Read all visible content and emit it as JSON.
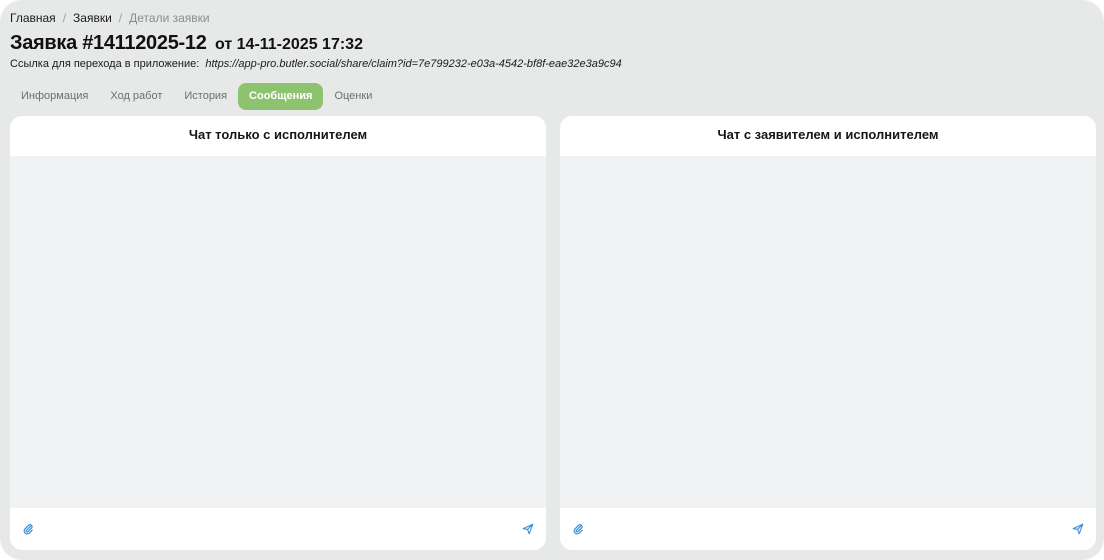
{
  "breadcrumb": {
    "items": [
      "Главная",
      "Заявки",
      "Детали заявки"
    ],
    "separator": "/"
  },
  "title": {
    "number": "Заявка #14112025-12",
    "date": "от 14-11-2025 17:32"
  },
  "share": {
    "label": "Ссылка для перехода в приложение:",
    "url": "https://app-pro.butler.social/share/claim?id=7e799232-e03a-4542-bf8f-eae32e3a9c94"
  },
  "tabs": [
    {
      "label": "Информация",
      "active": false
    },
    {
      "label": "Ход работ",
      "active": false
    },
    {
      "label": "История",
      "active": false
    },
    {
      "label": "Сообщения",
      "active": true
    },
    {
      "label": "Оценки",
      "active": false
    }
  ],
  "chats": {
    "executor": {
      "title": "Чат только с исполнителем"
    },
    "applicant_executor": {
      "title": "Чат с заявителем и исполнителем"
    }
  },
  "icons": {
    "attach": "paperclip-icon",
    "send": "send-icon"
  },
  "colors": {
    "background": "#e6e9e7",
    "active_tab": "#8dc26f",
    "icon_accent": "#3b8fd9",
    "chat_area": "#f1f2f3"
  }
}
